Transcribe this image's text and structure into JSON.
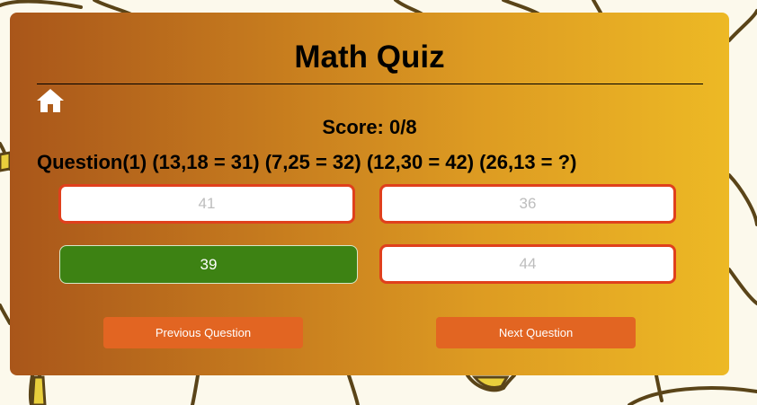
{
  "quiz": {
    "title": "Math Quiz",
    "score_text": "Score: 0/8",
    "question_text": "Question(1) (13,18 = 31) (7,25 = 32) (12,30 = 42) (26,13 = ?)",
    "options": [
      "41",
      "36",
      "39",
      "44"
    ],
    "selected_option": "39"
  },
  "navigation": {
    "previous_label": "Previous Question",
    "next_label": "Next Question"
  },
  "icons": {
    "home": "home-icon"
  },
  "colors": {
    "option_border": "#e0401c",
    "selected_option": "#3d8213",
    "nav_button": "#e26522",
    "card_gradient_start": "#a9561a",
    "card_gradient_end": "#edb925"
  }
}
